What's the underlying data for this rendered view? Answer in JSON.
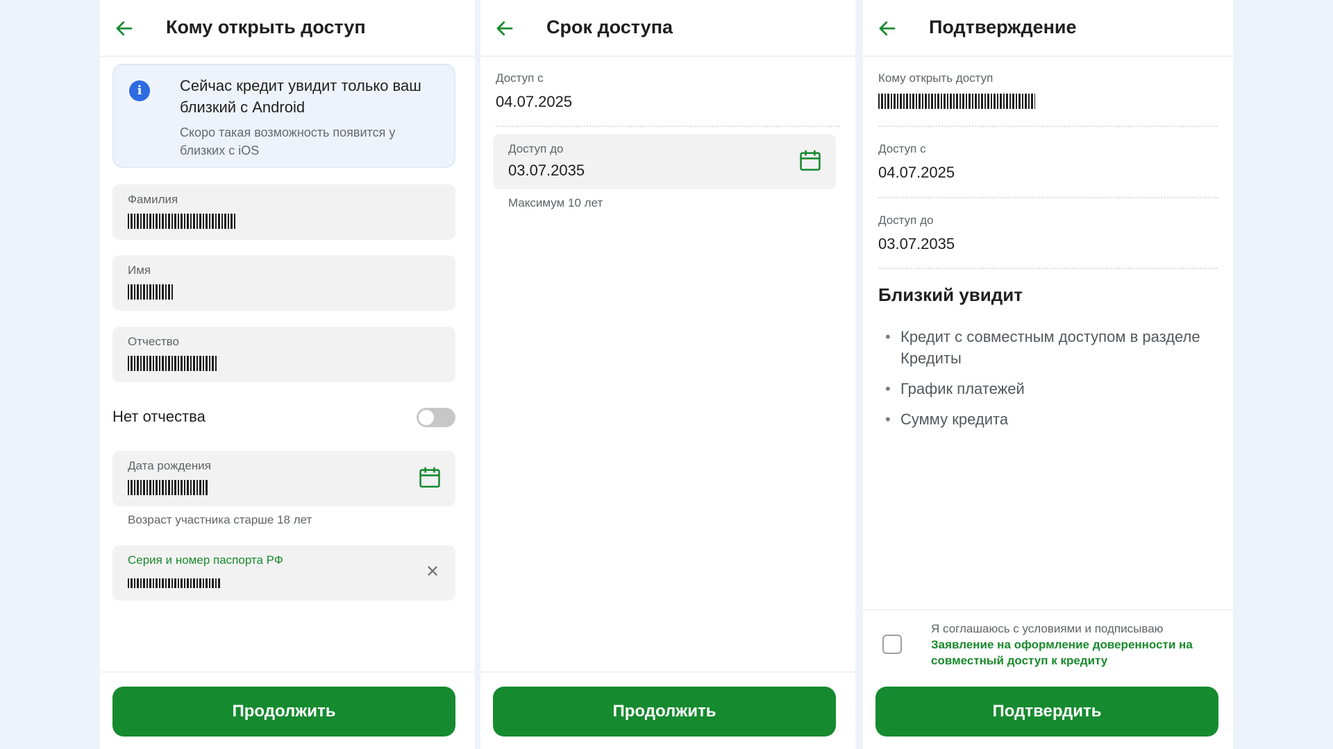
{
  "colors": {
    "accent": "#168a2f",
    "page_bg": "#eef3fb",
    "info_icon": "#2c6be0"
  },
  "screen1": {
    "title": "Кому открыть доступ",
    "back_icon": "arrow-left-icon",
    "info": {
      "icon": "info-icon",
      "title": "Сейчас кредит увидит только ваш близкий с Android",
      "subtitle": "Скоро такая возможность появится у близких с iOS"
    },
    "fields": {
      "last_name": {
        "label": "Фамилия"
      },
      "first_name": {
        "label": "Имя"
      },
      "patronymic": {
        "label": "Отчество"
      },
      "birth_date": {
        "label": "Дата рождения",
        "icon": "calendar-icon",
        "helper": "Возраст участника старше 18 лет"
      },
      "passport": {
        "label": "Серия и номер паспорта РФ",
        "icon": "close-icon"
      }
    },
    "no_patronymic": {
      "label": "Нет отчества",
      "enabled": false
    },
    "continue_label": "Продолжить"
  },
  "screen2": {
    "title": "Срок доступа",
    "back_icon": "arrow-left-icon",
    "access_from": {
      "label": "Доступ с",
      "value": "04.07.2025"
    },
    "access_to": {
      "label": "Доступ до",
      "value": "03.07.2035",
      "icon": "calendar-icon",
      "helper": "Максимум 10 лет"
    },
    "continue_label": "Продолжить"
  },
  "screen3": {
    "title": "Подтверждение",
    "back_icon": "arrow-left-icon",
    "recipient": {
      "label": "Кому открыть доступ"
    },
    "access_from": {
      "label": "Доступ с",
      "value": "04.07.2025"
    },
    "access_to": {
      "label": "Доступ до",
      "value": "03.07.2035"
    },
    "section_title": "Близкий увидит",
    "bullets": [
      "Кредит с совместным доступом в разделе Кредиты",
      "График платежей",
      "Сумму кредита"
    ],
    "consent": {
      "checked": false,
      "text": "Я соглашаюсь с условиями и подписываю",
      "link": "Заявление на оформление доверенности на совместный доступ к кредиту"
    },
    "confirm_label": "Подтвердить"
  }
}
